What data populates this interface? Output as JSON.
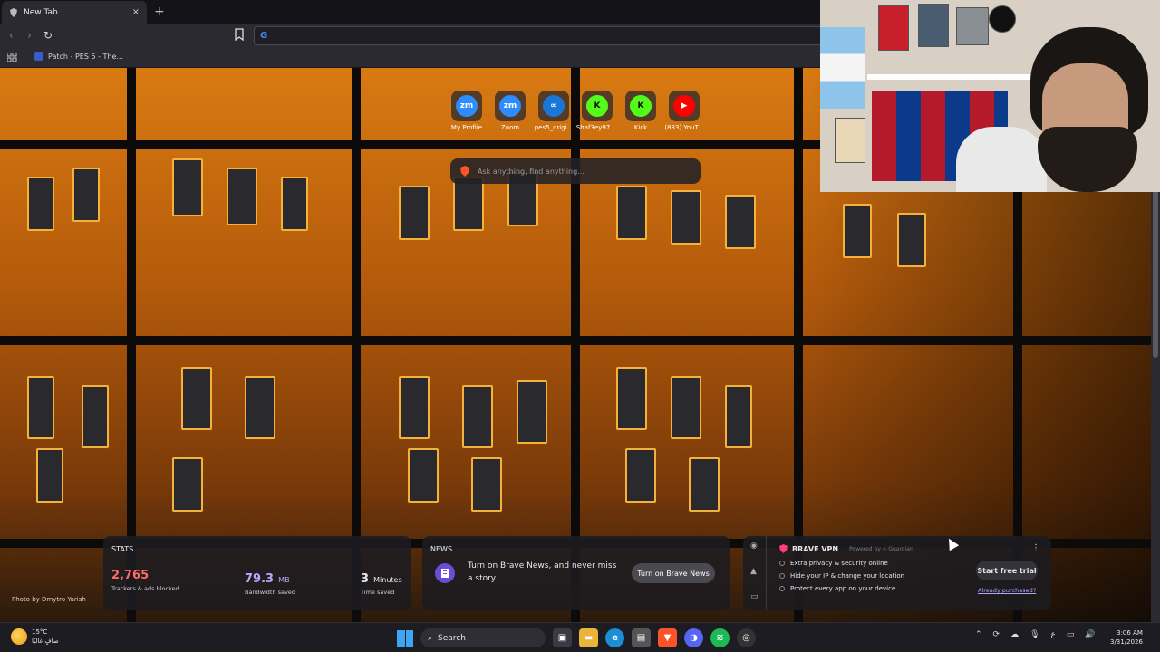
{
  "browser": {
    "tab": {
      "title": "New Tab",
      "icon": "brave-icon",
      "close": "×"
    },
    "new_tab": "+",
    "nav": {
      "back": "‹",
      "forward": "›",
      "reload": "↻"
    },
    "address": {
      "value": "",
      "engine_icon": "google-icon"
    },
    "bookmarks": [
      {
        "label": "Patch - PES 5 - The..."
      }
    ]
  },
  "newtab": {
    "top_sites": [
      {
        "label": "My Profile",
        "icon": "zm",
        "color": "#2d8cff"
      },
      {
        "label": "Zoom",
        "icon": "zm",
        "color": "#2d8cff"
      },
      {
        "label": "pes5_origi...",
        "icon": "∞",
        "color": "#1a77d8"
      },
      {
        "label": "Shaf3ey97 ...",
        "icon": "K",
        "color": "#53fc18"
      },
      {
        "label": "Kick",
        "icon": "K",
        "color": "#53fc18"
      },
      {
        "label": "(883) YouT...",
        "icon": "▶",
        "color": "#ff0000"
      }
    ],
    "search_placeholder": "Ask anything, find anything...",
    "photo_credit": "Photo by Dmytro Yarish",
    "stats": {
      "title": "STATS",
      "trackers": {
        "value": "2,765",
        "desc": "Trackers & ads blocked",
        "color": "#ff6b6b"
      },
      "bandwidth": {
        "value": "79.3",
        "unit": "MB",
        "desc": "Bandwidth saved",
        "color": "#b8a6ff"
      },
      "time": {
        "value": "3",
        "unit": "Minutes",
        "desc": "Time saved",
        "color": "#ffffff"
      }
    },
    "news": {
      "title": "NEWS",
      "text": "Turn on Brave News, and never miss a story",
      "button": "Turn on Brave News"
    },
    "vpn": {
      "name": "BRAVE VPN",
      "powered": "Powered by ◇ Guardian",
      "features": [
        "Extra privacy & security online",
        "Hide your IP & change your location",
        "Protect every app on your device"
      ],
      "button": "Start free trial",
      "link": "Already purchased?"
    }
  },
  "taskbar": {
    "weather": {
      "temp": "15°C",
      "desc": "صافٍ غالبًا"
    },
    "search": "Search",
    "clock": {
      "time": "3:06 AM",
      "date": "3/31/2026"
    },
    "lang": "ع"
  }
}
